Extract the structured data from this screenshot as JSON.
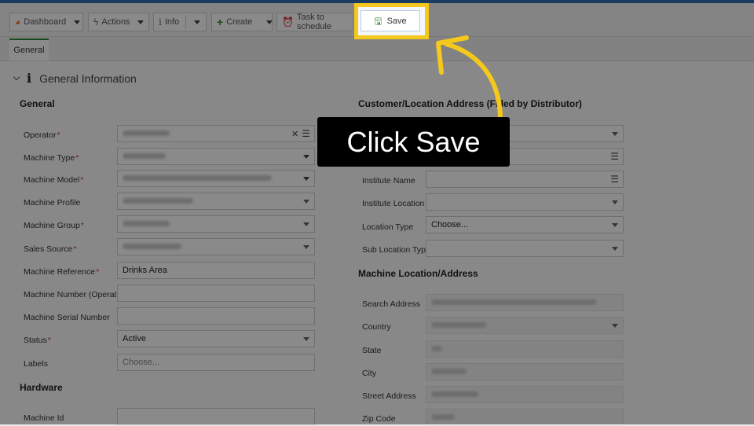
{
  "toolbar": {
    "dashboard_label": "Dashboard",
    "actions_label": "Actions",
    "info_label": "Info",
    "create_label": "Create",
    "task_label": "Task to schedule",
    "save_label": "Save"
  },
  "tabs": [
    {
      "label": "General"
    }
  ],
  "section_title": "General Information",
  "left": {
    "group_title": "General",
    "fields": {
      "operator": {
        "label": "Operator"
      },
      "machine_type": {
        "label": "Machine Type"
      },
      "machine_model": {
        "label": "Machine Model"
      },
      "machine_profile": {
        "label": "Machine Profile"
      },
      "machine_group": {
        "label": "Machine Group"
      },
      "sales_source": {
        "label": "Sales Source"
      },
      "machine_reference": {
        "label": "Machine Reference",
        "value": "Drinks Area"
      },
      "machine_number": {
        "label": "Machine Number (Operator)",
        "value": ""
      },
      "machine_serial": {
        "label": "Machine Serial Number",
        "value": ""
      },
      "status": {
        "label": "Status",
        "value": "Active"
      },
      "labels": {
        "label": "Labels",
        "placeholder": "Choose..."
      }
    },
    "hardware_title": "Hardware",
    "machine_id": {
      "label": "Machine Id",
      "value": ""
    }
  },
  "right": {
    "group_title": "Customer/Location Address (Filled by Distributor)",
    "fields": {
      "institute_name": {
        "label": "Institute Name",
        "value": ""
      },
      "institute_location": {
        "label": "Institute Location",
        "value": ""
      },
      "location_type": {
        "label": "Location Type",
        "value": "Choose..."
      },
      "sub_location_type": {
        "label": "Sub Location Type",
        "value": ""
      }
    },
    "address_title": "Machine Location/Address",
    "address_fields": {
      "search_address": {
        "label": "Search Address"
      },
      "country": {
        "label": "Country"
      },
      "state": {
        "label": "State"
      },
      "city": {
        "label": "City"
      },
      "street_address": {
        "label": "Street Address"
      },
      "zip_code": {
        "label": "Zip Code"
      }
    }
  },
  "overlay": {
    "callout_text": "Click Save",
    "highlight_color": "#f4c81d"
  },
  "colors": {
    "accent_blue": "#2f6db5",
    "tab_green": "#2e8b3a",
    "required_red": "#c0392b"
  }
}
